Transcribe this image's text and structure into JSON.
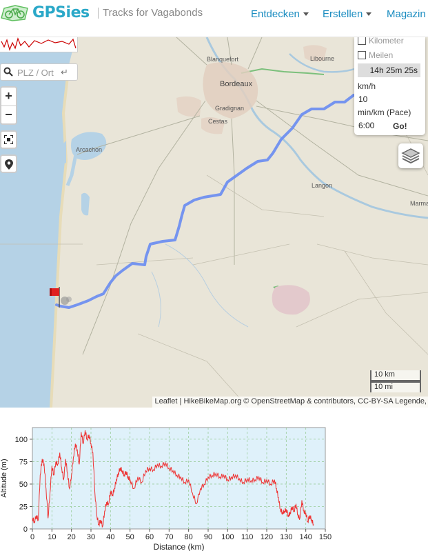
{
  "header": {
    "logo_text": "GPSies",
    "tagline": "Tracks for Vagabonds",
    "nav": [
      {
        "label": "Entdecken",
        "has_caret": true
      },
      {
        "label": "Erstellen",
        "has_caret": true
      },
      {
        "label": "Magazin",
        "has_caret": false
      }
    ]
  },
  "map": {
    "search": {
      "placeholder": "PLZ / Ort",
      "enter_glyph": "↵"
    },
    "zoom": {
      "in": "+",
      "out": "−"
    },
    "places": [
      {
        "name": "Blanquefort"
      },
      {
        "name": "Libourne"
      },
      {
        "name": "Bordeaux"
      },
      {
        "name": "Gradignan"
      },
      {
        "name": "Cestas"
      },
      {
        "name": "Arcachon"
      },
      {
        "name": "Langon"
      },
      {
        "name": "Marma"
      }
    ],
    "calculator": {
      "kilometer_label": "Kilometer",
      "meilen_label": "Meilen",
      "duration": "14h 25m 25s",
      "speed_label": "km/h",
      "speed_value": "10",
      "pace_label": "min/km (Pace)",
      "pace_value": "6:00",
      "go_label": "Go!"
    },
    "scale": {
      "km": "10 km",
      "mi": "10 mi"
    },
    "attribution": "Leaflet | HikeBikeMap.org © OpenStreetMap & contributors, CC-BY-SA Legende,",
    "colors": {
      "route": "#6f8ff0",
      "water": "#b3d1e4",
      "land": "#e8e3d6",
      "flag": "#e02020"
    }
  },
  "chart_data": {
    "type": "line",
    "xlabel": "Distance (km)",
    "ylabel": "Altitude (m)",
    "xlim": [
      0,
      150
    ],
    "ylim": [
      0,
      113
    ],
    "xticks": [
      0,
      10,
      20,
      30,
      40,
      50,
      60,
      70,
      80,
      90,
      100,
      110,
      120,
      130,
      140,
      150
    ],
    "yticks": [
      0,
      25,
      50,
      75,
      100
    ],
    "grid": true,
    "colors": {
      "line": "#ee3333",
      "background": "#dff1fa",
      "grid": "#99cc99"
    },
    "series": [
      {
        "x": [
          0,
          1,
          2,
          3,
          4,
          5,
          6,
          7,
          8,
          9,
          10,
          11,
          12,
          13,
          14,
          15,
          16,
          17,
          18,
          19,
          20,
          21,
          22,
          23,
          24,
          25,
          26,
          27,
          28,
          29,
          30,
          31,
          32,
          33,
          34,
          35,
          36,
          37,
          38,
          39,
          40,
          41,
          42,
          43,
          44,
          45,
          46,
          47,
          48,
          49,
          50,
          52,
          54,
          56,
          58,
          60,
          62,
          64,
          66,
          68,
          70,
          72,
          74,
          76,
          78,
          80,
          82,
          84,
          86,
          88,
          90,
          92,
          94,
          96,
          98,
          100,
          102,
          104,
          106,
          108,
          110,
          112,
          114,
          116,
          118,
          120,
          122,
          124,
          125,
          126,
          127,
          128,
          129,
          130,
          131,
          132,
          133,
          134,
          135,
          136,
          137,
          138,
          139,
          140,
          141,
          142,
          143,
          144
        ],
        "y": [
          12,
          8,
          15,
          10,
          60,
          78,
          72,
          45,
          12,
          40,
          70,
          60,
          75,
          72,
          85,
          68,
          55,
          78,
          62,
          45,
          60,
          80,
          95,
          88,
          72,
          108,
          95,
          110,
          100,
          105,
          95,
          85,
          40,
          15,
          5,
          10,
          3,
          20,
          30,
          28,
          42,
          38,
          45,
          55,
          62,
          68,
          65,
          60,
          64,
          58,
          55,
          45,
          58,
          52,
          65,
          68,
          66,
          72,
          70,
          74,
          68,
          65,
          60,
          58,
          52,
          55,
          40,
          28,
          45,
          50,
          58,
          60,
          62,
          58,
          60,
          55,
          58,
          60,
          56,
          52,
          56,
          54,
          55,
          58,
          52,
          55,
          50,
          55,
          45,
          35,
          22,
          18,
          20,
          22,
          15,
          18,
          25,
          20,
          28,
          15,
          12,
          32,
          20,
          18,
          8,
          15,
          10,
          5
        ]
      }
    ]
  }
}
